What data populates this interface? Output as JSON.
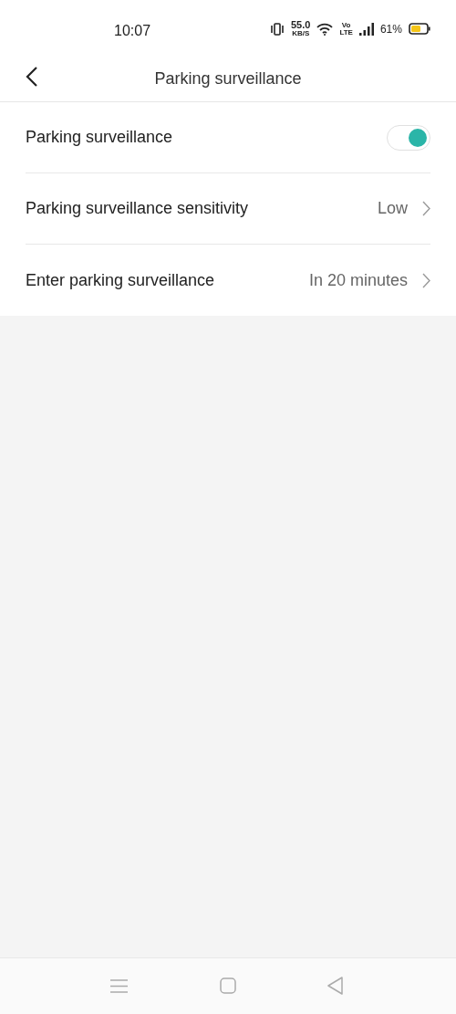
{
  "status_bar": {
    "time": "10:07",
    "speed": "55.0",
    "speed_unit": "KB/S",
    "volte_top": "Vo",
    "volte_bottom": "LTE",
    "battery": "61%"
  },
  "header": {
    "title": "Parking surveillance"
  },
  "settings": [
    {
      "kind": "toggle",
      "label": "Parking surveillance",
      "on": true
    },
    {
      "kind": "value",
      "label": "Parking surveillance sensitivity",
      "value": "Low"
    },
    {
      "kind": "value",
      "label": "Enter parking surveillance",
      "value": "In 20 minutes"
    }
  ]
}
